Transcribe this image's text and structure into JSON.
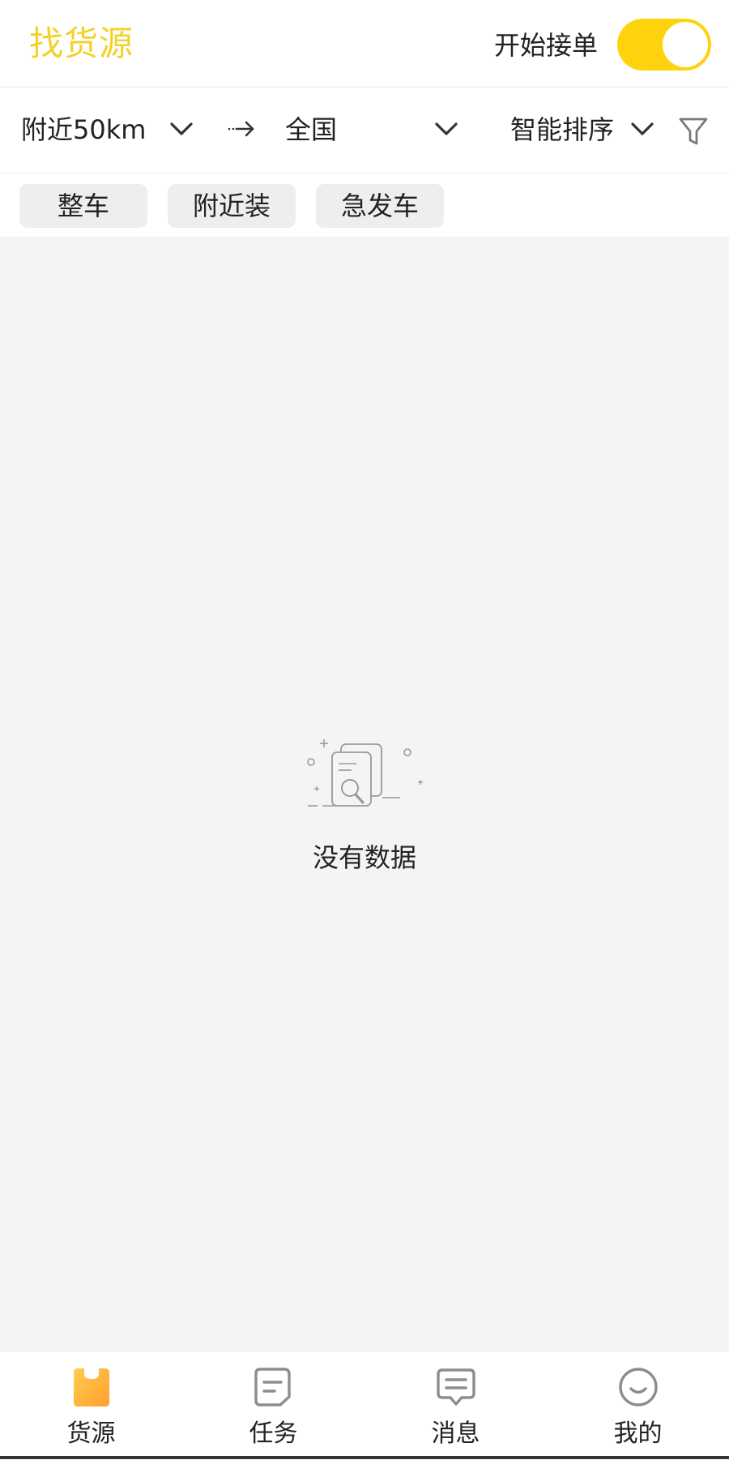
{
  "header": {
    "title": "找货源",
    "accept_label": "开始接单",
    "toggle_on": true
  },
  "filters": {
    "origin": "附近50km",
    "destination": "全国",
    "sort": "智能排序"
  },
  "tags": [
    {
      "label": "整车"
    },
    {
      "label": "附近装"
    },
    {
      "label": "急发车"
    }
  ],
  "empty_state": {
    "message": "没有数据"
  },
  "tabbar": {
    "items": [
      {
        "label": "货源",
        "icon": "cargo-bag-icon",
        "active": true
      },
      {
        "label": "任务",
        "icon": "task-document-icon",
        "active": false
      },
      {
        "label": "消息",
        "icon": "message-bubble-icon",
        "active": false
      },
      {
        "label": "我的",
        "icon": "smiley-face-icon",
        "active": false
      }
    ]
  },
  "colors": {
    "accent": "#f3d12a",
    "toggle": "#fed20c",
    "tab_active_start": "#ffcd4f",
    "tab_active_end": "#ff9f2e",
    "tab_inactive_icon": "#8d8d8d",
    "content_bg": "#f4f4f4",
    "tag_bg": "#eeeeee"
  }
}
